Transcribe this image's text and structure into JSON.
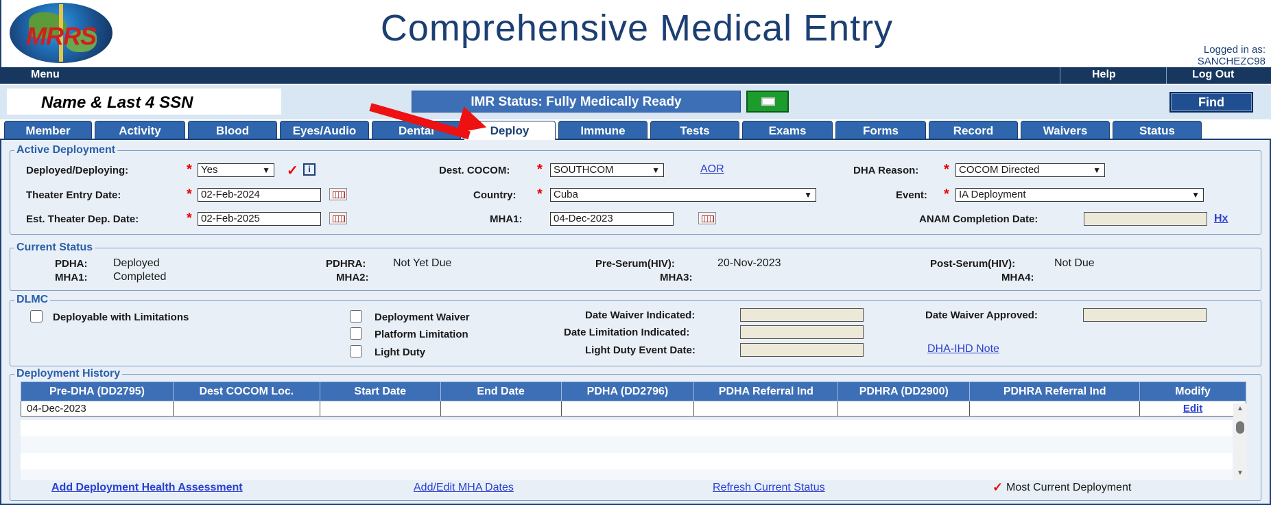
{
  "app": {
    "title": "Comprehensive Medical Entry",
    "logo_text": "MRRS",
    "logged_in_label": "Logged in as:",
    "logged_in_user": "SANCHEZC98"
  },
  "menubar": {
    "menu": "Menu",
    "help": "Help",
    "logout": "Log Out"
  },
  "identity": {
    "name_ssn": "Name & Last 4 SSN",
    "imr_status": "IMR Status: Fully Medically Ready",
    "find": "Find"
  },
  "tabs": [
    "Member",
    "Activity",
    "Blood",
    "Eyes/Audio",
    "Dental",
    "Deploy",
    "Immune",
    "Tests",
    "Exams",
    "Forms",
    "Record",
    "Waivers",
    "Status"
  ],
  "active_tab": "Deploy",
  "active_deployment": {
    "legend": "Active Deployment",
    "deployed_label": "Deployed/Deploying:",
    "deployed_value": "Yes",
    "theater_entry_label": "Theater Entry Date:",
    "theater_entry_value": "02-Feb-2024",
    "est_dep_label": "Est. Theater Dep. Date:",
    "est_dep_value": "02-Feb-2025",
    "cocom_label": "Dest. COCOM:",
    "cocom_value": "SOUTHCOM",
    "aor_link": "AOR",
    "country_label": "Country:",
    "country_value": "Cuba",
    "mha1_label": "MHA1:",
    "mha1_value": "04-Dec-2023",
    "dha_reason_label": "DHA Reason:",
    "dha_reason_value": "COCOM Directed",
    "event_label": "Event:",
    "event_value": "IA Deployment",
    "anam_label": "ANAM Completion Date:",
    "anam_value": "",
    "hx_link": "Hx"
  },
  "current_status": {
    "legend": "Current Status",
    "pdha_label": "PDHA:",
    "pdha_value": "Deployed",
    "mha1_label": "MHA1:",
    "mha1_value": "Completed",
    "pdhra_label": "PDHRA:",
    "pdhra_value": "Not Yet Due",
    "mha2_label": "MHA2:",
    "pre_serum_label": "Pre-Serum(HIV):",
    "pre_serum_value": "20-Nov-2023",
    "mha3_label": "MHA3:",
    "post_serum_label": "Post-Serum(HIV):",
    "post_serum_value": "Not Due",
    "mha4_label": "MHA4:"
  },
  "dlmc": {
    "legend": "DLMC",
    "deployable_limitations": "Deployable with Limitations",
    "deployment_waiver": "Deployment Waiver",
    "platform_limitation": "Platform Limitation",
    "light_duty": "Light Duty",
    "date_waiver_indicated": "Date Waiver Indicated:",
    "date_limitation_indicated": "Date Limitation Indicated:",
    "light_duty_event_date": "Light Duty Event Date:",
    "date_waiver_approved": "Date Waiver Approved:",
    "dha_ihd_note": "DHA-IHD Note"
  },
  "history": {
    "legend": "Deployment History",
    "columns": [
      "Pre-DHA (DD2795)",
      "Dest COCOM Loc.",
      "Start Date",
      "End Date",
      "PDHA (DD2796)",
      "PDHA Referral Ind",
      "PDHRA (DD2900)",
      "PDHRA Referral Ind",
      "Modify"
    ],
    "rows": [
      [
        "04-Dec-2023",
        "",
        "",
        "",
        "",
        "",
        "",
        "",
        "Edit"
      ]
    ]
  },
  "footer": {
    "add_dha": "Add Deployment Health Assessment",
    "add_edit_mha": "Add/Edit MHA Dates",
    "refresh_status": "Refresh Current Status",
    "most_current": "Most Current Deployment"
  },
  "colors": {
    "brand": "#1c3f73",
    "tab": "#2f66ad",
    "required": "#e00000",
    "print_button": "#1c9c2c",
    "annotation_arrow": "#ee1111"
  },
  "icons": [
    "globe-logo-icon",
    "checkmark-icon",
    "info-icon",
    "printer-icon",
    "calendar-icon",
    "chevron-down-icon",
    "scroll-up-icon",
    "scroll-down-icon"
  ]
}
